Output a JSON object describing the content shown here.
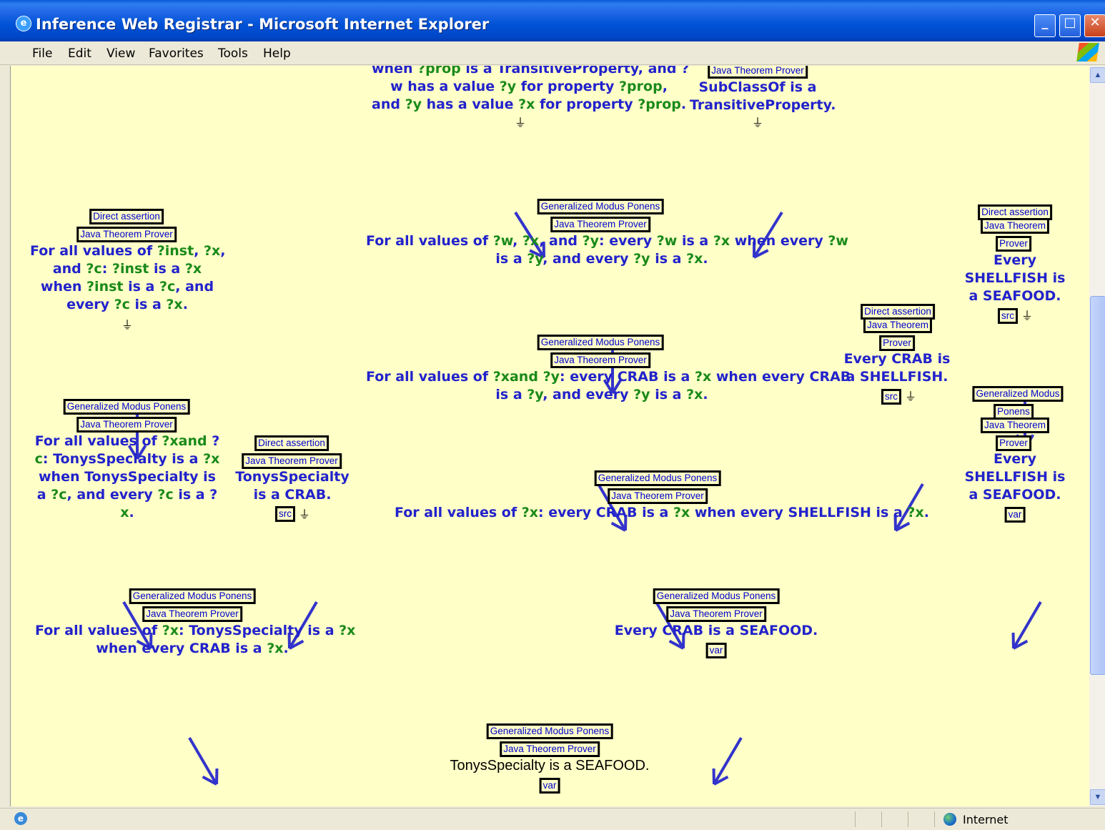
{
  "window": {
    "title": "Inference Web Registrar - Microsoft Internet Explorer",
    "minimize": "_",
    "maximize": "□",
    "close": "✕"
  },
  "menu": [
    "File",
    "Edit",
    "View",
    "Favorites",
    "Tools",
    "Help"
  ],
  "status": {
    "zone": "Internet"
  },
  "colors": {
    "statement_blue": "#2222cc",
    "variable_green": "#1a8a1a",
    "arrow_blue": "#3333cc",
    "page_bg": "#ffffc8"
  },
  "labels": {
    "direct_assertion": "Direct assertion",
    "jtp": "Java Theorem Prover",
    "jtp_a": "Java Theorem",
    "jtp_b": "Prover",
    "gmp": "Generalized Modus Ponens",
    "gmp_a": "Generalized Modus",
    "gmp_b": "Ponens",
    "src": "src",
    "var": "var",
    "ground": "⏚"
  },
  "nodes": {
    "top_left": {
      "line1": "when ?prop is a TransitiveProperty, and ?",
      "line2": "w has a value ?y for property ?prop,",
      "line3": "and ?y has a value ?x for property ?prop."
    },
    "top_right": {
      "line1": "SubClassOf is a",
      "line2": "TransitiveProperty."
    },
    "gmp_transitive": {
      "line1": "For all values of ?w, ?x, and ?y: every ?w is a ?x when every ?w",
      "line2": "is a ?y, and every ?y is a ?x."
    },
    "assert_instance": {
      "line1": "For all values of ?inst, ?x,",
      "line2": "and ?c: ?inst is a ?x",
      "line3": "when ?inst is a ?c, and",
      "line4": "every ?c is a ?x."
    },
    "gmp_crab": {
      "line1": "For all values of ?xand ?y: every CRAB is a ?x when every CRAB",
      "line2": "is a ?y, and every ?y is a ?x."
    },
    "crab_shellfish": {
      "line1": "Every CRAB is",
      "line2": "a SHELLFISH."
    },
    "shellfish_seafood_top": {
      "line1": "Every",
      "line2": "SHELLFISH is",
      "line3": "a SEAFOOD."
    },
    "shellfish_seafood_gmp": {
      "line1": "Every",
      "line2": "SHELLFISH is",
      "line3": "a SEAFOOD."
    },
    "gmp_tonys": {
      "line1": "For all values of ?xand ?",
      "line2": "c: TonysSpecialty is a ?x",
      "line3": "when TonysSpecialty is",
      "line4": "a ?c, and every ?c is a ?",
      "line5": "x."
    },
    "tonys_crab": {
      "line1": "TonysSpecialty",
      "line2": "is a CRAB."
    },
    "gmp_crab_shellfish": {
      "line1": "For all values of ?x: every CRAB is a ?x when every SHELLFISH is a ?x."
    },
    "gmp_tonys_crab": {
      "line1": "For all values of ?x: TonysSpecialty is a ?x",
      "line2": "when every CRAB is a ?x."
    },
    "crab_seafood": {
      "line1": "Every CRAB is a SEAFOOD."
    },
    "final": {
      "line1": "TonysSpecialty is a SEAFOOD."
    }
  },
  "arrows": [
    [
      706,
      205,
      746,
      268
    ],
    [
      1079,
      205,
      1040,
      268
    ],
    [
      842,
      393,
      842,
      458
    ],
    [
      177,
      485,
      177,
      550
    ],
    [
      822,
      585,
      860,
      650
    ],
    [
      1276,
      585,
      1238,
      650
    ],
    [
      1419,
      470,
      1419,
      535
    ],
    [
      158,
      750,
      196,
      815
    ],
    [
      428,
      750,
      390,
      815
    ],
    [
      903,
      750,
      941,
      815
    ],
    [
      1441,
      750,
      1403,
      815
    ],
    [
      250,
      940,
      288,
      1005
    ],
    [
      1022,
      940,
      984,
      1005
    ]
  ]
}
